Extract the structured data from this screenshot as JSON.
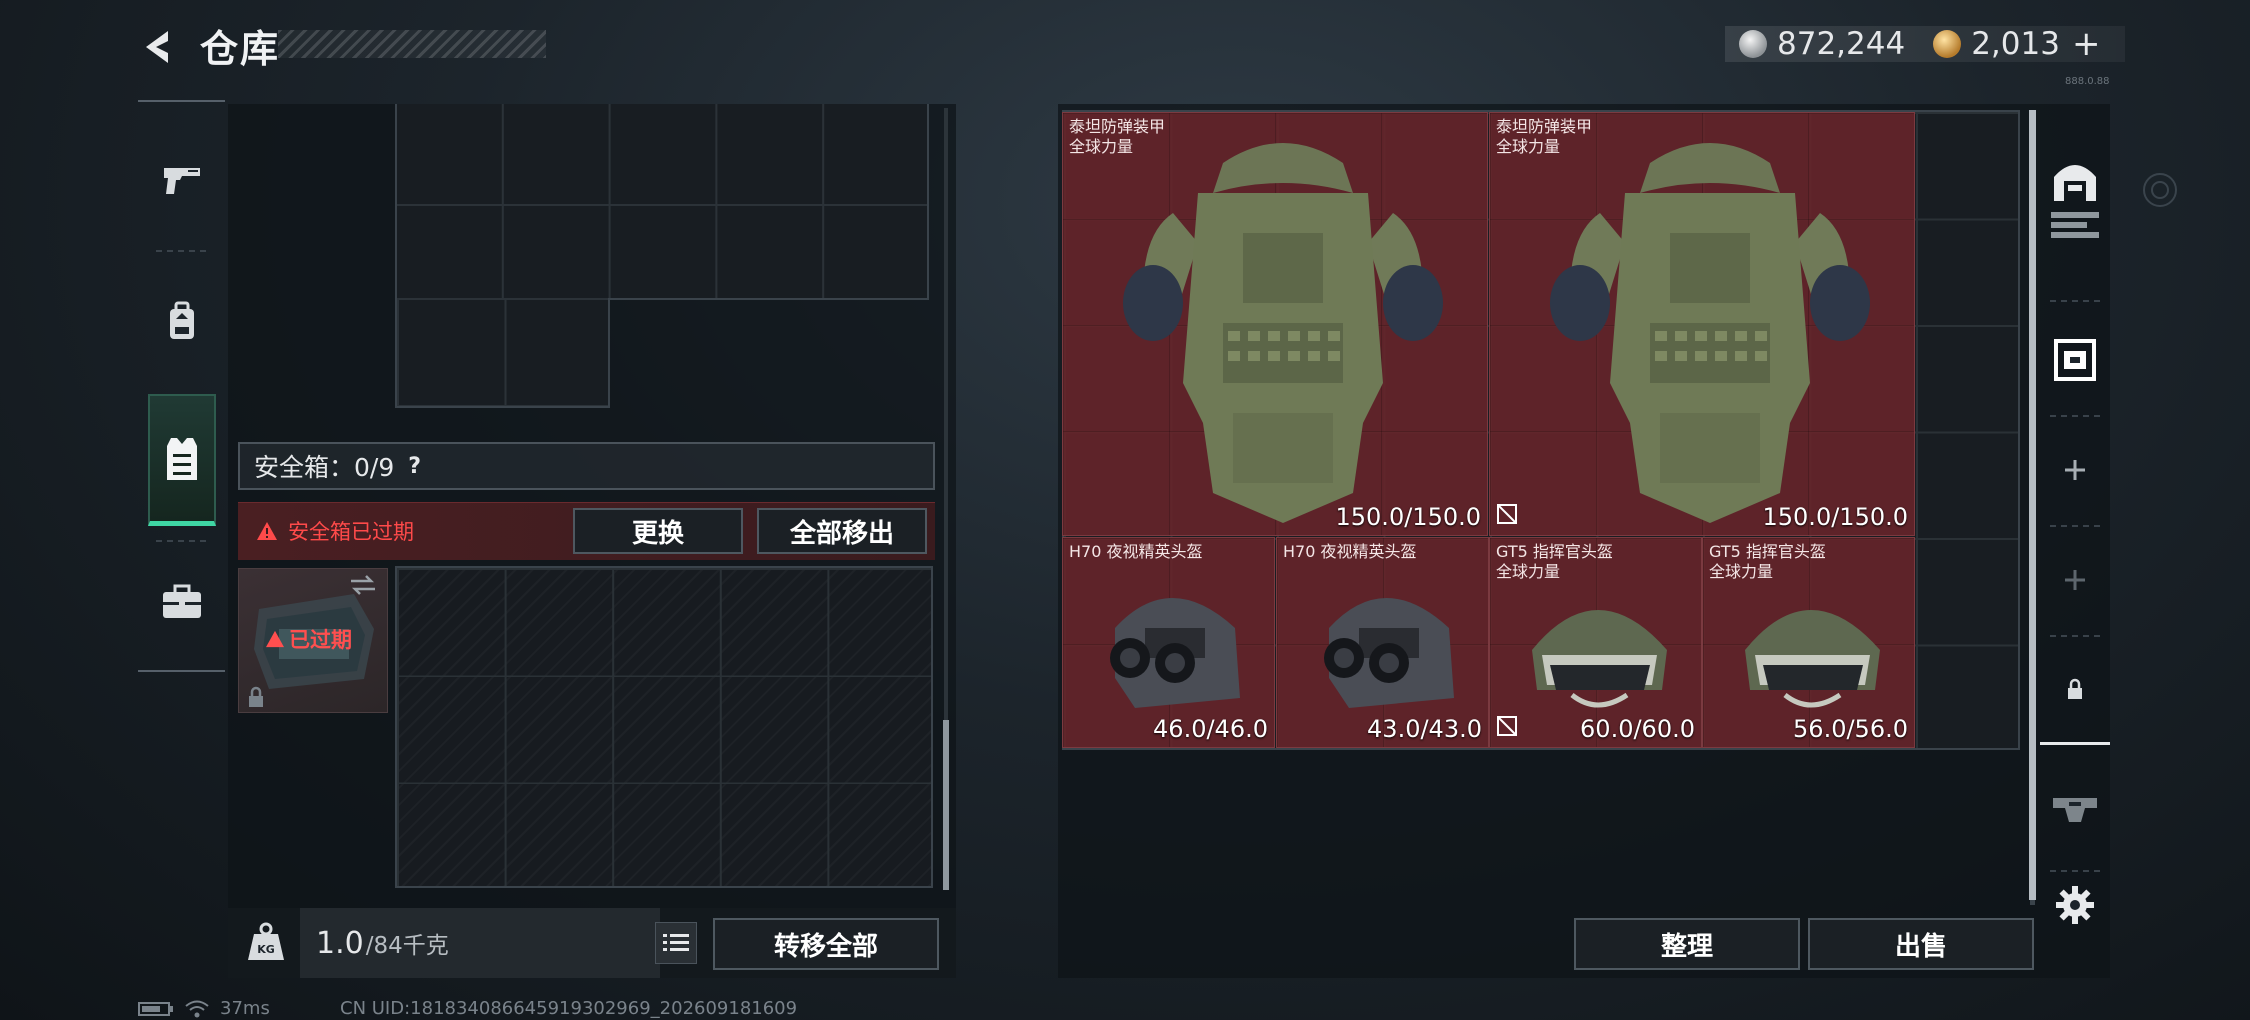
{
  "header": {
    "title": "仓库",
    "currency_silver": "872,244",
    "currency_gold": "2,013",
    "currency_plus": "+",
    "version_tag": "888.0.88"
  },
  "left_tabs": [
    {
      "icon": "pistol-icon"
    },
    {
      "icon": "backpack-icon"
    },
    {
      "icon": "vest-icon",
      "active": true
    },
    {
      "icon": "briefcase-icon"
    }
  ],
  "safe_box": {
    "label": "安全箱：",
    "count": "0/9",
    "help": "?",
    "expired_notice": "安全箱已过期",
    "replace_label": "更换",
    "move_all_label": "全部移出",
    "item_expired_label": "已过期"
  },
  "footer_left": {
    "weight_value": "1.0",
    "weight_unit": "/84千克",
    "weight_icon_text": "KG",
    "transfer_all_label": "转移全部"
  },
  "stash_items": [
    {
      "name": "泰坦防弹装甲",
      "sub": "全球力量",
      "durability": "150.0/150.0",
      "marked": false
    },
    {
      "name": "泰坦防弹装甲",
      "sub": "全球力量",
      "durability": "150.0/150.0",
      "marked": true
    },
    {
      "name": "H70 夜视精英头盔",
      "sub": "",
      "durability": "46.0/46.0",
      "marked": false
    },
    {
      "name": "H70 夜视精英头盔",
      "sub": "",
      "durability": "43.0/43.0",
      "marked": false
    },
    {
      "name": "GT5 指挥官头盔",
      "sub": "全球力量",
      "durability": "60.0/60.0",
      "marked": true
    },
    {
      "name": "GT5 指挥官头盔",
      "sub": "全球力量",
      "durability": "56.0/56.0",
      "marked": false
    }
  ],
  "right_actions": {
    "sort_label": "整理",
    "sell_label": "出售"
  },
  "status": {
    "ping": "37ms",
    "uid": "CN UID:18183408664591930296​9_202609181609"
  },
  "colors": {
    "accent_green": "#3fd6a4",
    "item_red": "#68242a",
    "warning_red": "#ff4a4a"
  }
}
